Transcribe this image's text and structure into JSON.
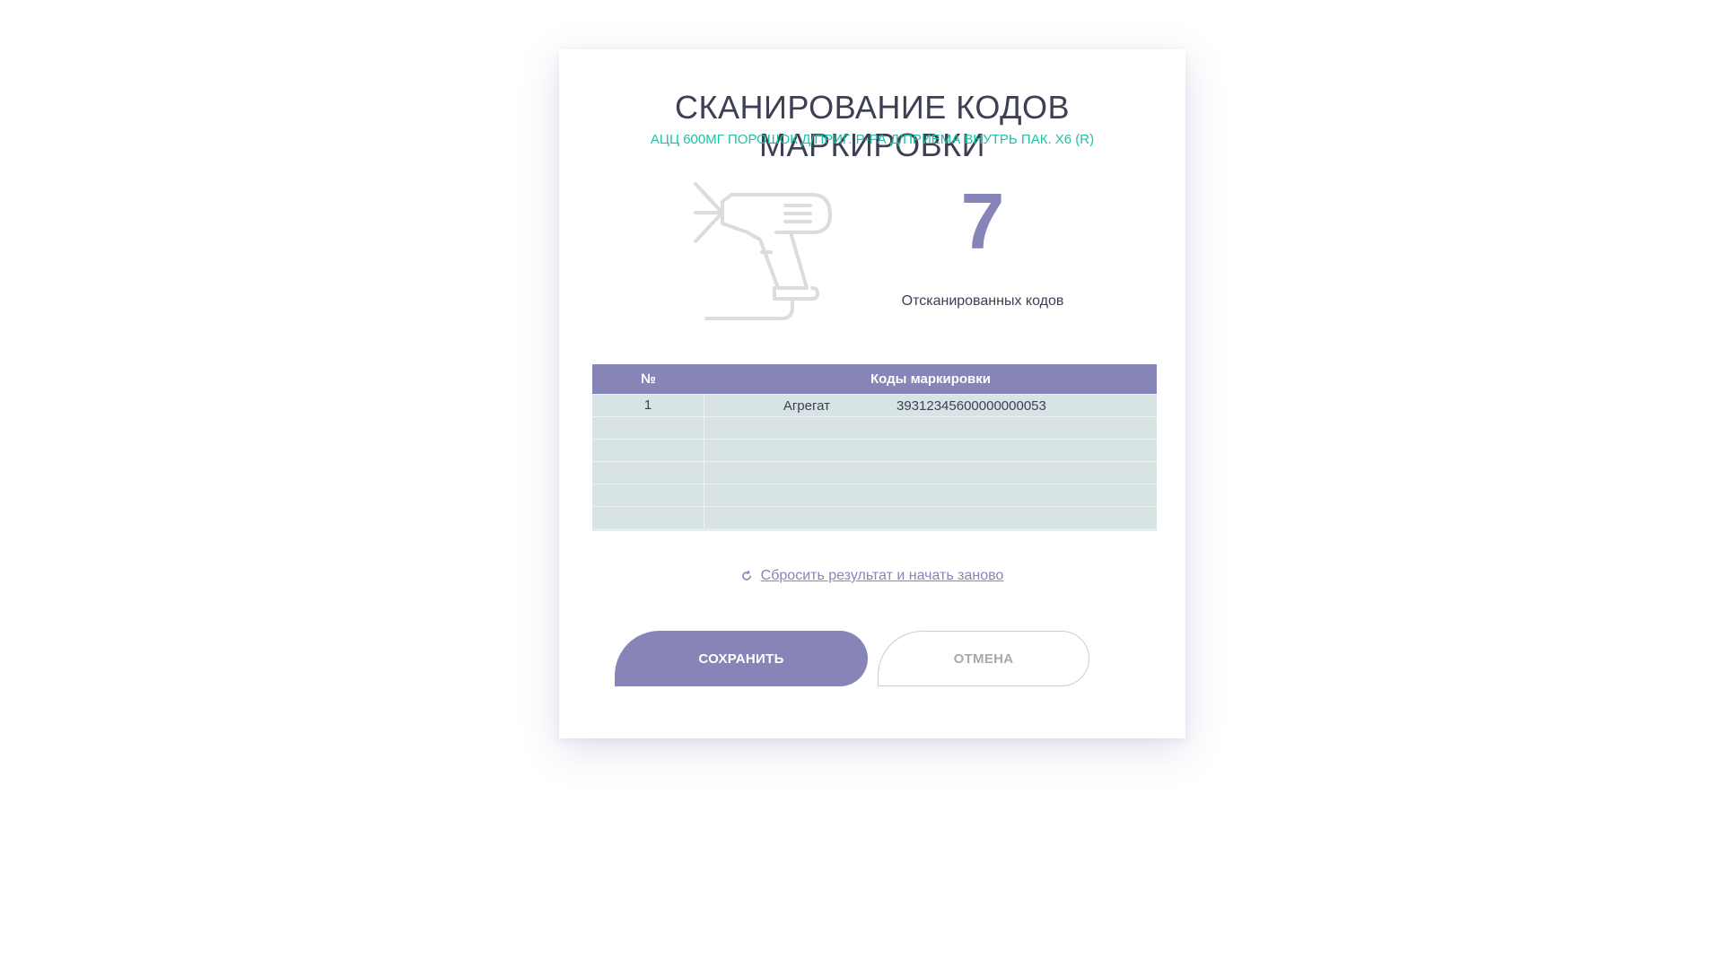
{
  "dialog": {
    "title": "СКАНИРОВАНИЕ КОДОВ МАРКИРОВКИ",
    "subtitle": "АЦЦ 600МГ ПОРОШОК Д/ПРИГ. Р-РА Д/ПРИЕМА ВНУТРЬ ПАК. Х6 (R)"
  },
  "counter": {
    "value": "7",
    "label": "Отсканированных кодов"
  },
  "table": {
    "headers": {
      "number": "№",
      "codes": "Коды маркировки"
    },
    "rows": [
      {
        "number": "1",
        "type": "Агрегат",
        "code": "39312345600000000053"
      },
      {
        "number": "",
        "type": "",
        "code": ""
      },
      {
        "number": "",
        "type": "",
        "code": ""
      },
      {
        "number": "",
        "type": "",
        "code": ""
      },
      {
        "number": "",
        "type": "",
        "code": ""
      },
      {
        "number": "",
        "type": "",
        "code": ""
      }
    ]
  },
  "reset": {
    "label": "Сбросить результат и начать заново",
    "icon": "refresh-icon"
  },
  "buttons": {
    "save_label": "СОХРАНИТЬ",
    "cancel_label": "ОТМЕНА"
  },
  "colors": {
    "accent": "#8784b8",
    "subtitle": "#1fc2a4",
    "row_background": "#d7e4e3",
    "text": "#3d3f55"
  }
}
